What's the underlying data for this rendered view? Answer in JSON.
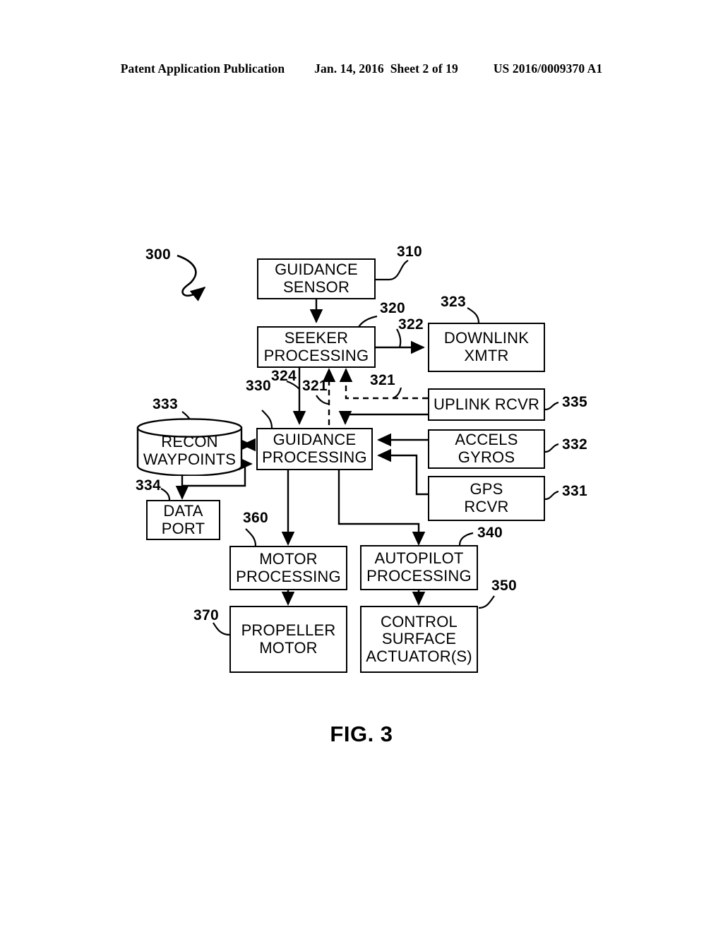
{
  "header": {
    "publication": "Patent Application Publication",
    "date": "Jan. 14, 2016",
    "sheet": "Sheet 2 of 19",
    "patent_number": "US 2016/0009370 A1"
  },
  "figure": {
    "caption": "FIG. 3",
    "system_ref": "300"
  },
  "blocks": [
    {
      "id": "guidance-sensor",
      "lines": [
        "GUIDANCE",
        "SENSOR"
      ],
      "ref": "310"
    },
    {
      "id": "seeker-processing",
      "lines": [
        "SEEKER",
        "PROCESSING"
      ],
      "ref": "320"
    },
    {
      "id": "downlink-xmtr",
      "lines": [
        "DOWNLINK",
        "XMTR"
      ],
      "ref": "323"
    },
    {
      "id": "uplink-rcvr",
      "lines": [
        "UPLINK RCVR"
      ],
      "ref": "335"
    },
    {
      "id": "accels-gyros",
      "lines": [
        "ACCELS",
        "GYROS"
      ],
      "ref": "332"
    },
    {
      "id": "gps-rcvr",
      "lines": [
        "GPS",
        "RCVR"
      ],
      "ref": "331"
    },
    {
      "id": "recon-waypoints",
      "lines": [
        "RECON",
        "WAYPOINTS"
      ],
      "ref": "333"
    },
    {
      "id": "guidance-processing",
      "lines": [
        "GUIDANCE",
        "PROCESSING"
      ],
      "ref": "330"
    },
    {
      "id": "data-port",
      "lines": [
        "DATA",
        "PORT"
      ],
      "ref": "334"
    },
    {
      "id": "motor-processing",
      "lines": [
        "MOTOR",
        "PROCESSING"
      ],
      "ref": "360"
    },
    {
      "id": "autopilot-processing",
      "lines": [
        "AUTOPILOT",
        "PROCESSING"
      ],
      "ref": "340"
    },
    {
      "id": "propeller-motor",
      "lines": [
        "PROPELLER",
        "MOTOR"
      ],
      "ref": "370"
    },
    {
      "id": "control-surface-actuators",
      "lines": [
        "CONTROL",
        "SURFACE",
        "ACTUATOR(S)"
      ],
      "ref": "350"
    }
  ],
  "signal_refs": {
    "downlink_signal": "322",
    "seeker_to_guidance": "324",
    "uplink_to_seeker": "321",
    "guidance_to_seeker": "321"
  },
  "colors": {
    "ink": "#000000",
    "paper": "#ffffff"
  }
}
